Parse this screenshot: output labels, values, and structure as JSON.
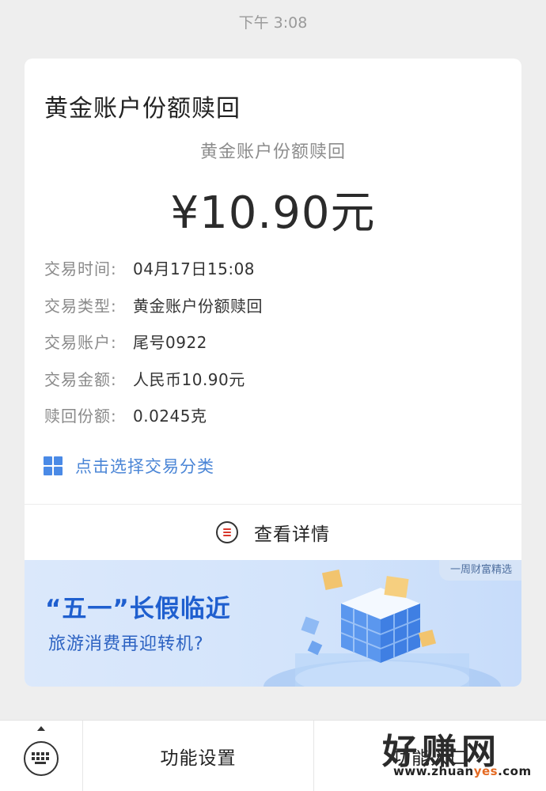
{
  "status": {
    "time": "下午 3:08"
  },
  "card": {
    "title": "黄金账户份额赎回",
    "subtitle": "黄金账户份额赎回",
    "amount": "¥10.90元",
    "details": [
      {
        "label": "交易时间:",
        "value": "04月17日15:08"
      },
      {
        "label": "交易类型:",
        "value": "黄金账户份额赎回"
      },
      {
        "label": "交易账户:",
        "value": "尾号0922"
      },
      {
        "label": "交易金额:",
        "value": "人民币10.90元"
      },
      {
        "label": "赎回份额:",
        "value": "0.0245克"
      }
    ],
    "category_link": "点击选择交易分类",
    "view_details": "查看详情"
  },
  "banner": {
    "tag": "一周财富精选",
    "headline": "“五一”长假临近",
    "subline": "旅游消费再迎转机?"
  },
  "bottom_bar": {
    "settings": "功能设置",
    "right": "功能入口"
  },
  "watermark": {
    "big": "好赚网",
    "small_a": "www.zhuan",
    "small_b": "yes",
    "small_c": ".com"
  },
  "colors": {
    "accent_blue": "#4a85d6",
    "banner_blue": "#1f5fcf",
    "icon_red": "#d9362b"
  }
}
